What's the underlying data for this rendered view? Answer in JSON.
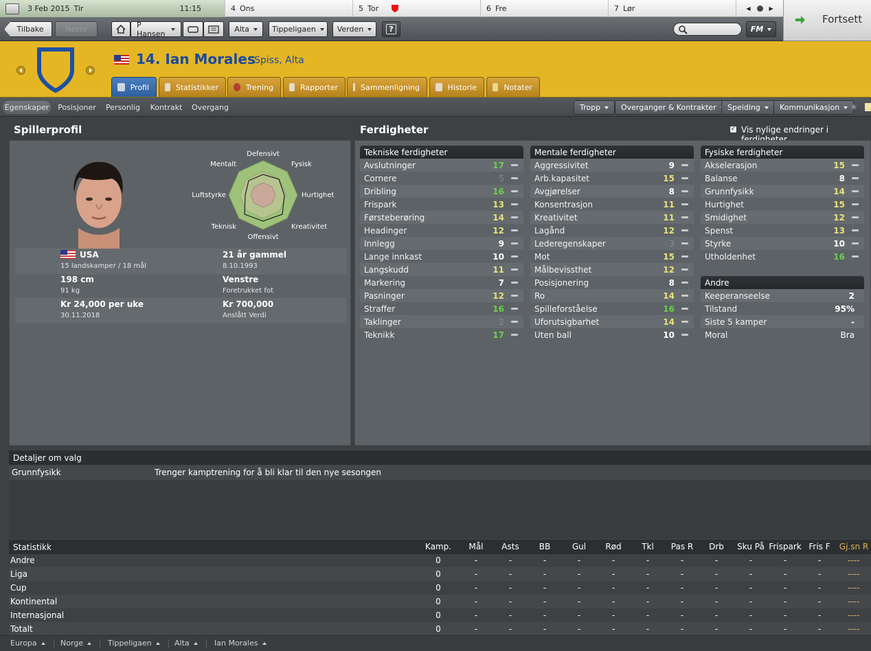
{
  "calendar": {
    "today": {
      "date": "3 Feb 2015",
      "day": "Tir",
      "time": "11:15"
    },
    "days": [
      {
        "num": "4",
        "name": "Ons"
      },
      {
        "num": "5",
        "name": "Tor"
      },
      {
        "num": "6",
        "name": "Fre"
      },
      {
        "num": "7",
        "name": "Lør"
      }
    ]
  },
  "nav": {
    "back": "Tilbake",
    "next": "Neste",
    "manager": "P Hansen",
    "club": "Alta",
    "league": "Tippeligaen",
    "world": "Verden",
    "help": "?",
    "fm": "FM",
    "continue": "Fortsett"
  },
  "player": {
    "number_name": "14. Ian Morales",
    "position_club": "Spiss, Alta",
    "flag_country": "USA"
  },
  "profile_tabs": [
    "Profil",
    "Statistikker",
    "Trening",
    "Rapporter",
    "Sammenligning",
    "Historie",
    "Notater"
  ],
  "sub_tabs": [
    "Egenskaper",
    "Posisjoner",
    "Personlig",
    "Kontrakt",
    "Overgang"
  ],
  "sub_menus": [
    "Tropp",
    "Overganger & Kontrakter",
    "Speiding",
    "Kommunikasjon"
  ],
  "profile": {
    "title": "Spillerprofil",
    "radar_labels": [
      "Defensivt",
      "Fysisk",
      "Hurtighet",
      "Kreativitet",
      "Offensivt",
      "Teknisk",
      "Luftstyrke",
      "Mentalt"
    ],
    "info": {
      "country": "USA",
      "caps": "15 landskamper / 18 mål",
      "age": "21 år gammel",
      "dob": "8.10.1993",
      "height": "198 cm",
      "weight": "91 kg",
      "foot": "Venstre",
      "foot_label": "Foretrukket fot",
      "wage": "Kr 24,000 per uke",
      "contract_end": "30.11.2018",
      "value": "Kr 700,000",
      "value_label": "Anslått Verdi"
    }
  },
  "skills": {
    "title": "Ferdigheter",
    "recent_changes": "Vis nylige endringer i ferdigheter",
    "technical": {
      "title": "Tekniske ferdigheter",
      "items": [
        {
          "name": "Avslutninger",
          "value": 17
        },
        {
          "name": "Cornere",
          "value": 5
        },
        {
          "name": "Dribling",
          "value": 16
        },
        {
          "name": "Frispark",
          "value": 13
        },
        {
          "name": "Førsteberøring",
          "value": 14
        },
        {
          "name": "Headinger",
          "value": 12
        },
        {
          "name": "Innlegg",
          "value": 9
        },
        {
          "name": "Lange innkast",
          "value": 10
        },
        {
          "name": "Langskudd",
          "value": 11
        },
        {
          "name": "Markering",
          "value": 7
        },
        {
          "name": "Pasninger",
          "value": 12
        },
        {
          "name": "Straffer",
          "value": 16
        },
        {
          "name": "Taklinger",
          "value": 2
        },
        {
          "name": "Teknikk",
          "value": 17
        }
      ]
    },
    "mental": {
      "title": "Mentale ferdigheter",
      "items": [
        {
          "name": "Aggressivitet",
          "value": 9
        },
        {
          "name": "Arb.kapasitet",
          "value": 15
        },
        {
          "name": "Avgjørelser",
          "value": 8
        },
        {
          "name": "Konsentrasjon",
          "value": 11
        },
        {
          "name": "Kreativitet",
          "value": 11
        },
        {
          "name": "Lagånd",
          "value": 12
        },
        {
          "name": "Lederegenskaper",
          "value": 3
        },
        {
          "name": "Mot",
          "value": 15
        },
        {
          "name": "Målbevissthet",
          "value": 12
        },
        {
          "name": "Posisjonering",
          "value": 8
        },
        {
          "name": "Ro",
          "value": 14
        },
        {
          "name": "Spilleforståelse",
          "value": 16
        },
        {
          "name": "Uforutsigbarhet",
          "value": 14
        },
        {
          "name": "Uten ball",
          "value": 10
        }
      ]
    },
    "physical": {
      "title": "Fysiske ferdigheter",
      "items": [
        {
          "name": "Akselerasjon",
          "value": 15
        },
        {
          "name": "Balanse",
          "value": 8
        },
        {
          "name": "Grunnfysikk",
          "value": 14
        },
        {
          "name": "Hurtighet",
          "value": 15
        },
        {
          "name": "Smidighet",
          "value": 12
        },
        {
          "name": "Spenst",
          "value": 13
        },
        {
          "name": "Styrke",
          "value": 10
        },
        {
          "name": "Utholdenhet",
          "value": 16
        }
      ]
    },
    "other": {
      "title": "Andre",
      "items": [
        {
          "name": "Keeperanseelse",
          "value": "2"
        },
        {
          "name": "Tilstand",
          "value": "95%"
        },
        {
          "name": "Siste 5 kamper",
          "value": "-"
        },
        {
          "name": "Moral",
          "value": "Bra"
        }
      ]
    }
  },
  "details": {
    "title": "Detaljer om valg",
    "row_label": "Grunnfysikk",
    "row_text": "Trenger kamptrening for å bli klar til den nye sesongen"
  },
  "stats": {
    "title": "Statistikk",
    "columns": [
      "Kamp.",
      "Mål",
      "Asts",
      "BB",
      "Gul",
      "Rød",
      "Tkl",
      "Pas R",
      "Drb",
      "Sku På",
      "Frispark",
      "Fris F",
      "Gj.sn R"
    ],
    "rows": [
      {
        "label": "Andre",
        "apps": "0"
      },
      {
        "label": "Liga",
        "apps": "0"
      },
      {
        "label": "Cup",
        "apps": "0"
      },
      {
        "label": "Kontinental",
        "apps": "0"
      },
      {
        "label": "Internasjonal",
        "apps": "0"
      },
      {
        "label": "Totalt",
        "apps": "0"
      }
    ],
    "empty": "-",
    "empty_rating": "----"
  },
  "breadcrumbs": [
    "Europa",
    "Norge",
    "Tippeligaen",
    "Alta",
    "Ian Morales"
  ],
  "colors": {
    "header": "#e5b624",
    "name": "#1a4aa0",
    "high": "#69d14a",
    "good": "#e8e27a"
  }
}
